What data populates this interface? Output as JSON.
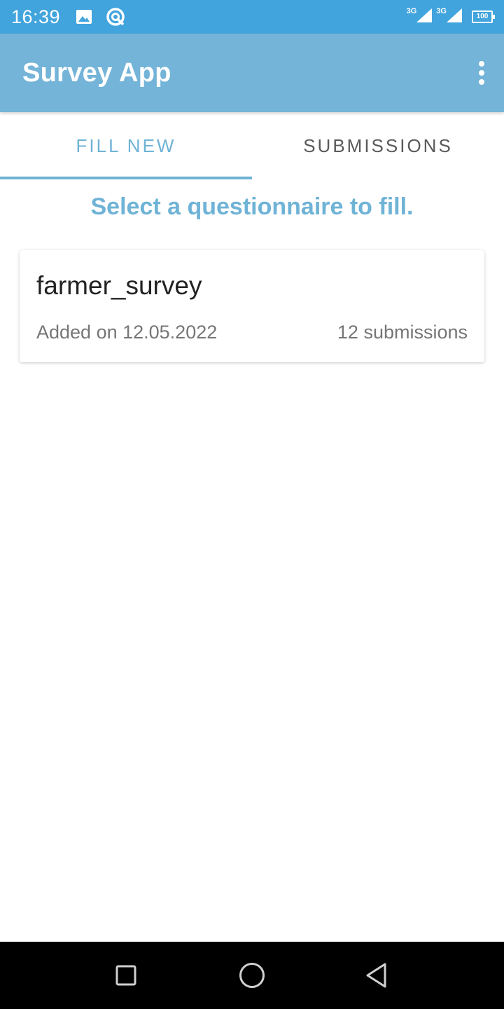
{
  "status_bar": {
    "time": "16:39",
    "icons": [
      "image-icon",
      "sync-icon",
      "signal-3g-icon",
      "signal-3g-icon",
      "battery-icon"
    ],
    "network_1": "3G",
    "network_2": "3G",
    "battery": "100"
  },
  "app_bar": {
    "title": "Survey App",
    "menu_icon": "more-vert-icon"
  },
  "tabs": [
    {
      "label": "FILL NEW",
      "active": true
    },
    {
      "label": "SUBMISSIONS",
      "active": false
    }
  ],
  "main": {
    "prompt": "Select a questionnaire to fill.",
    "questionnaires": [
      {
        "name": "farmer_survey",
        "added": "Added on 12.05.2022",
        "submissions": "12 submissions"
      }
    ]
  },
  "nav_bar": {
    "icons": [
      "recent-apps-icon",
      "home-icon",
      "back-icon"
    ]
  },
  "colors": {
    "status_bar": "#42a4dd",
    "app_bar": "#74b4d8",
    "accent": "#6fb3d6"
  }
}
